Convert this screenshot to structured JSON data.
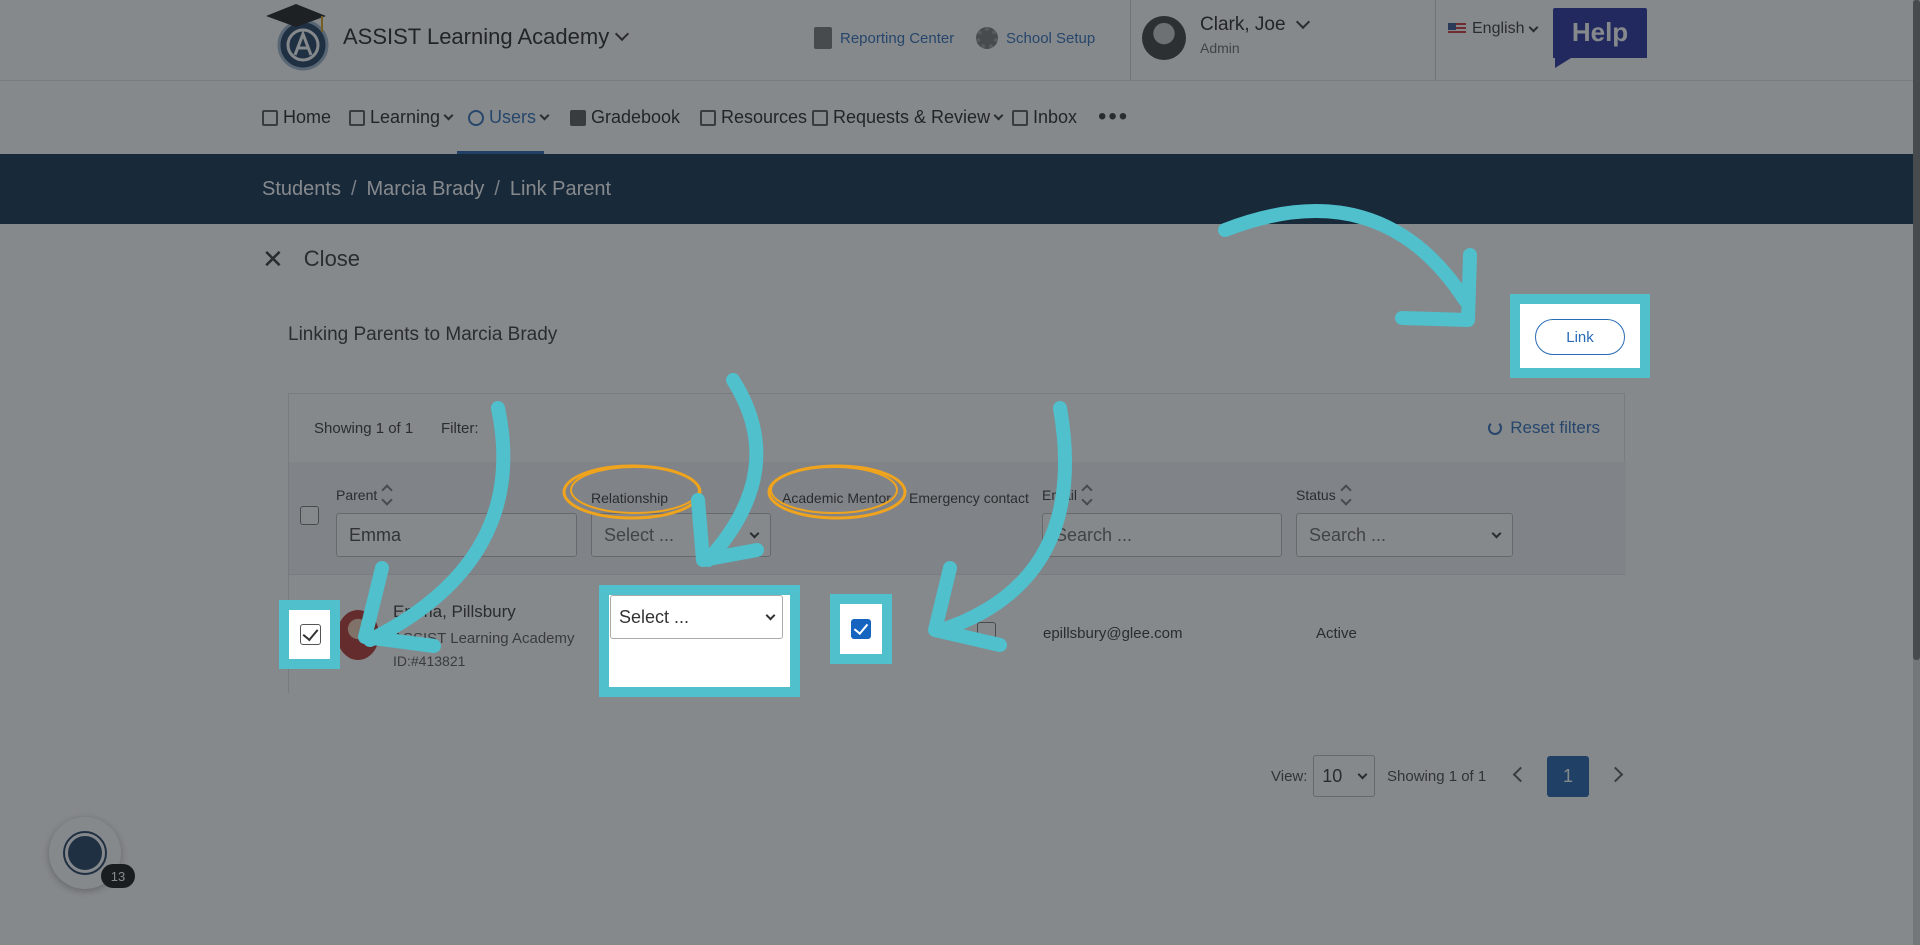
{
  "header": {
    "school_name": "ASSIST Learning Academy",
    "reporting_center": "Reporting Center",
    "school_setup": "School Setup",
    "user_name": "Clark, Joe",
    "user_role": "Admin",
    "language": "English",
    "help_label": "Help"
  },
  "nav": {
    "home": "Home",
    "learning": "Learning",
    "users": "Users",
    "gradebook": "Gradebook",
    "resources": "Resources",
    "requests": "Requests & Review",
    "inbox": "Inbox",
    "more": "•••"
  },
  "breadcrumb": {
    "students": "Students",
    "sep": "/",
    "student": "Marcia Brady",
    "current": "Link Parent"
  },
  "close_label": "Close",
  "title": "Linking Parents to Marcia Brady",
  "link_button": "Link",
  "table": {
    "showing": "Showing 1 of 1",
    "filter_label": "Filter:",
    "reset_filters": "Reset filters",
    "headers": {
      "parent": "Parent",
      "relationship": "Relationship",
      "academic_mentor": "Academic Mentor",
      "emergency_contact": "Emergency contact",
      "email": "Email",
      "status": "Status"
    },
    "filters": {
      "parent_value": "Emma",
      "relationship_placeholder": "Select ...",
      "email_placeholder": "Search ...",
      "status_placeholder": "Search ..."
    },
    "row": {
      "name": "Emma, Pillsbury",
      "school": "ASSIST Learning Academy",
      "id": "ID:#413821",
      "relationship": "Select ...",
      "email": "epillsbury@glee.com",
      "status": "Active",
      "selected": true,
      "academic_mentor": true,
      "emergency_contact": false
    }
  },
  "pagination": {
    "view_label": "View:",
    "page_size": "10",
    "showing": "Showing 1 of 1",
    "current_page": "1"
  },
  "chat": {
    "badge": "13"
  },
  "colors": {
    "highlight": "#4fc0cc",
    "circle": "#f0a31c",
    "primary": "#1d5fa8",
    "crumbbar": "#0d2a4a"
  }
}
